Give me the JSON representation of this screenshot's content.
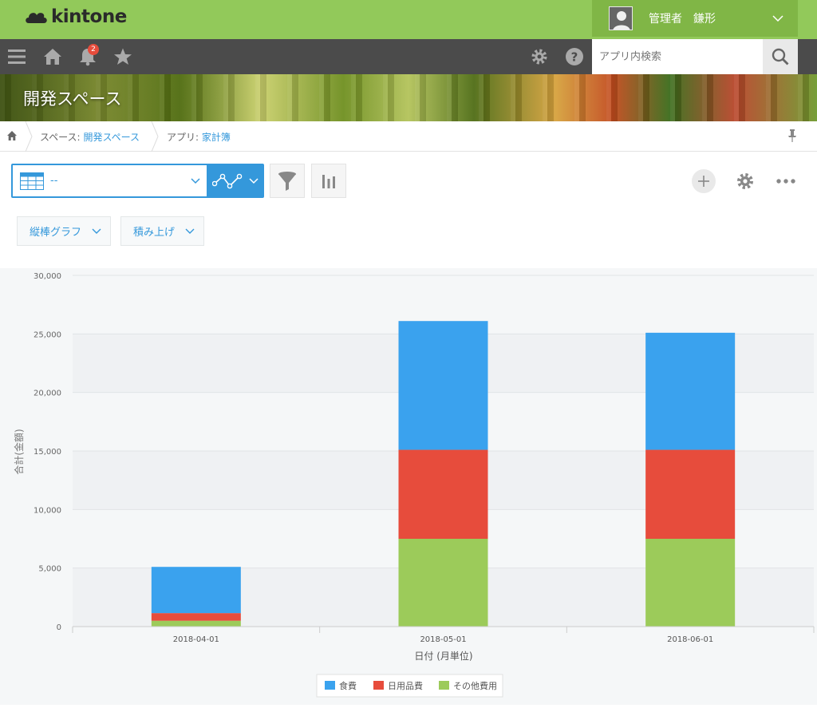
{
  "app": {
    "logo_text": "kintone",
    "user_name": "管理者　鎌形",
    "notification_count": "2",
    "search_placeholder": "アプリ内検索"
  },
  "banner": {
    "space_title": "開発スペース"
  },
  "breadcrumb": {
    "space_prefix": "スペース:",
    "space_name": "開発スペース",
    "app_prefix": "アプリ:",
    "app_name": "家計簿"
  },
  "view": {
    "selected": "--",
    "graph_type": "縦棒グラフ",
    "display_mode": "積み上げ"
  },
  "colors": {
    "accent": "#3498db",
    "header_green": "#92c95a",
    "toolbar": "#4b4b4b"
  },
  "icons": [
    "menu-icon",
    "home-icon",
    "bell-icon",
    "star-icon",
    "gear-icon",
    "help-icon",
    "search-icon",
    "table-icon",
    "line-chart-icon",
    "filter-icon",
    "bar-chart-icon",
    "plus-icon",
    "more-icon",
    "pin-icon",
    "chevron-down-icon"
  ],
  "chart_data": {
    "type": "bar",
    "stacked": true,
    "categories": [
      "2018-04-01",
      "2018-05-01",
      "2018-06-01"
    ],
    "series": [
      {
        "name": "食費",
        "color": "#3aa2ee",
        "values": [
          3950,
          11000,
          10000
        ]
      },
      {
        "name": "日用品費",
        "color": "#e74c3c",
        "values": [
          650,
          7600,
          7600
        ]
      },
      {
        "name": "その他費用",
        "color": "#9ccb5a",
        "values": [
          500,
          7500,
          7500
        ]
      }
    ],
    "xlabel": "日付 (月単位)",
    "ylabel": "合計(金額)",
    "ylim": [
      0,
      30000
    ],
    "yticks": [
      "0",
      "5,000",
      "10,000",
      "15,000",
      "20,000",
      "25,000",
      "30,000"
    ],
    "grid": true,
    "legend": "bottom"
  }
}
